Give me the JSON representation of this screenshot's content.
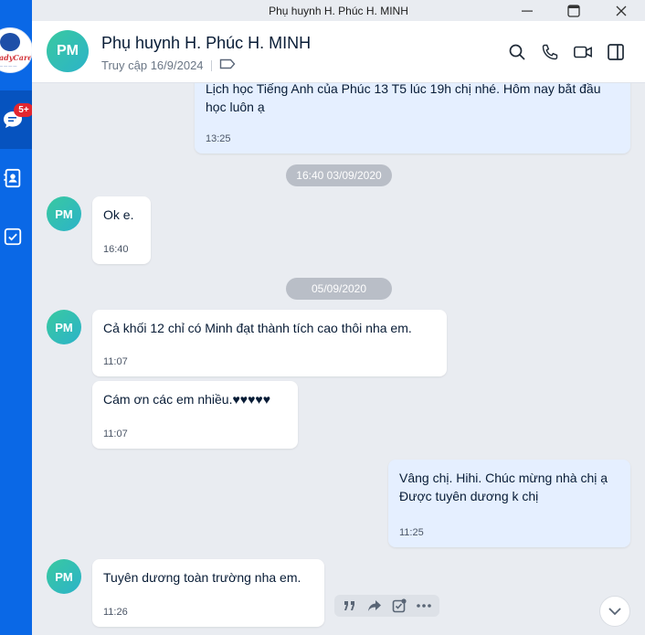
{
  "window": {
    "title": "Phụ huynh H. Phúc H. MINH"
  },
  "sidebar": {
    "badge": "5+"
  },
  "header": {
    "avatar": "PM",
    "name": "Phụ huynh H. Phúc H. MINH",
    "last_access": "Truy cập 16/9/2024"
  },
  "messages": [
    {
      "text": "Lịch học Tiếng Anh của  Phúc 13 T5 lúc 19h chị nhé. Hôm nay bắt đầu học luôn ạ",
      "time": "13:25",
      "sender": "me"
    },
    {
      "text": "Ok e.",
      "time": "16:40",
      "sender": "other"
    },
    {
      "text": "Cả khối 12 chỉ có Minh đạt thành tích cao thôi nha em.",
      "time": "11:07",
      "sender": "other"
    },
    {
      "text": "Cám ơn các em nhiều.♥♥♥♥♥",
      "time": "11:07",
      "sender": "other"
    },
    {
      "text": "Vâng chị. Hihi. Chúc mừng nhà chị ạ\n Được tuyên dương k chị",
      "time": "11:25",
      "sender": "me"
    },
    {
      "text": "Tuyên dương toàn trường nha em.",
      "time": "11:26",
      "sender": "other"
    }
  ],
  "dates": [
    "16:40 03/09/2020",
    "05/09/2020"
  ],
  "avatar_initials": "PM",
  "icons": {
    "sidebar": [
      "chat-icon",
      "contacts-icon",
      "todo-icon"
    ],
    "header": [
      "search-icon",
      "phone-icon",
      "video-icon",
      "sidebar-panel-icon"
    ],
    "window": [
      "minimize-icon",
      "maximize-icon",
      "close-icon"
    ],
    "message_actions": [
      "quote-icon",
      "forward-icon",
      "task-icon",
      "more-icon"
    ]
  },
  "colors": {
    "sidebar": "#0a68e6",
    "badge": "#e3262f",
    "my_bubble": "#e5efff",
    "avatar": "#2cb3c9"
  }
}
